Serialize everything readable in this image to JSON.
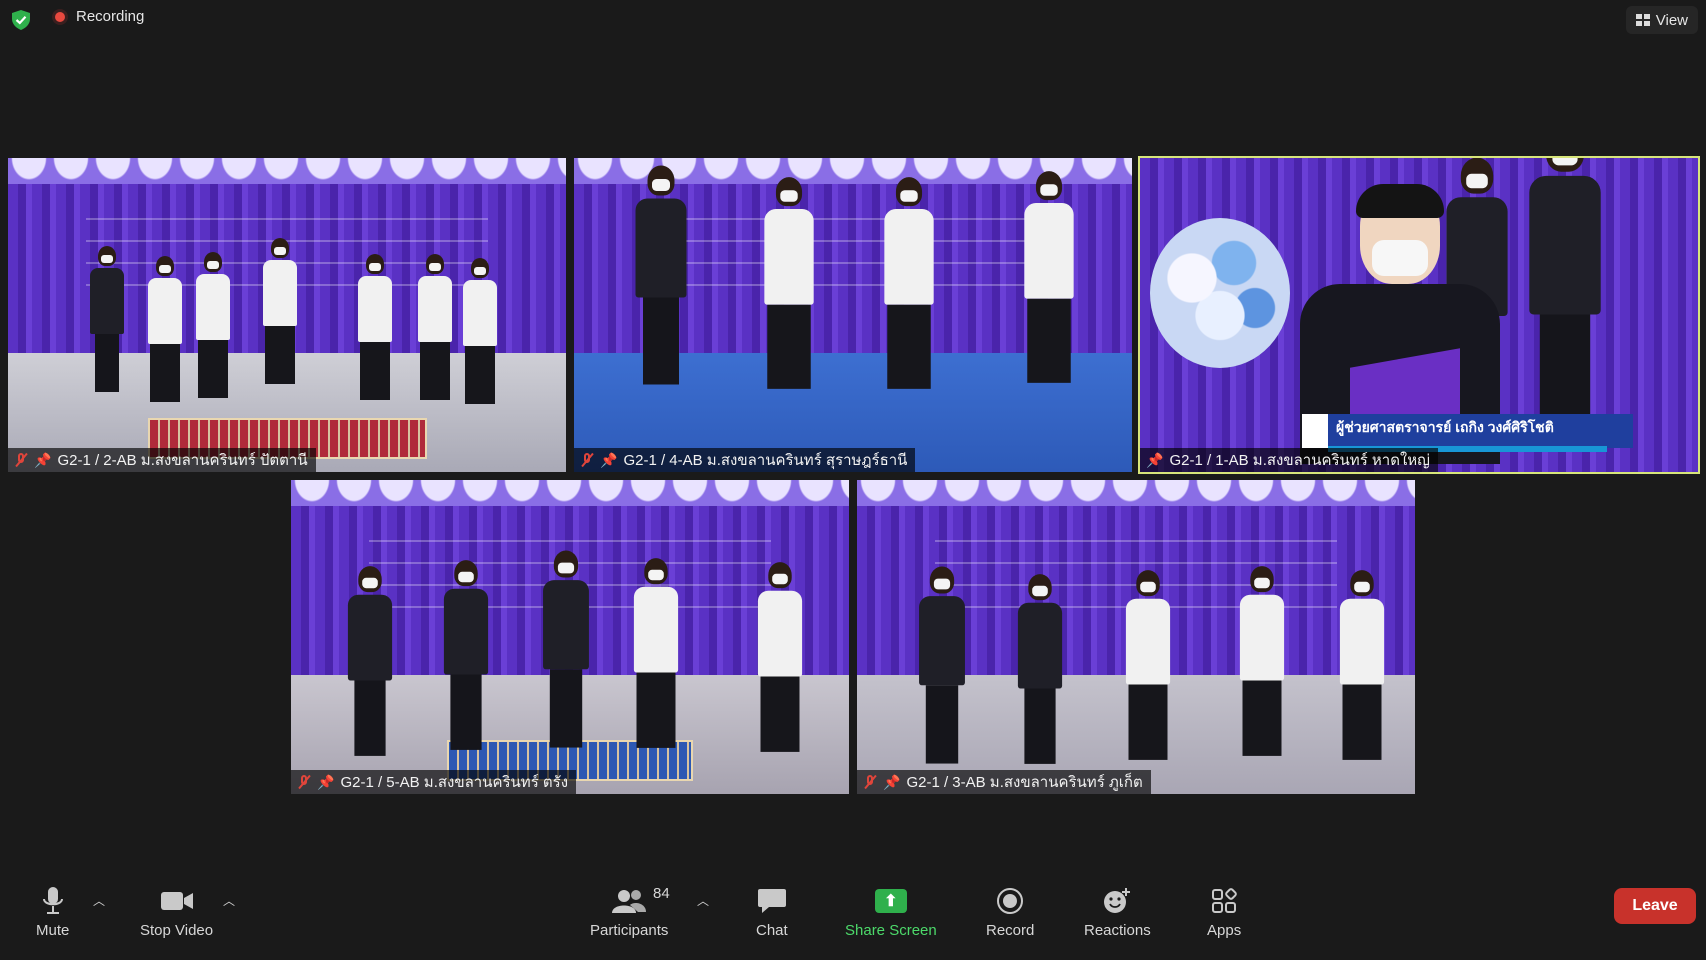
{
  "top": {
    "recording_label": "Recording",
    "view_label": "View"
  },
  "tiles": [
    {
      "label": "G2-1 / 2-AB ม.สงขลานครินทร์ ปัตตานี",
      "muted": true
    },
    {
      "label": "G2-1 / 4-AB ม.สงขลานครินทร์ สุราษฎร์ธานี",
      "muted": true
    },
    {
      "label": "G2-1 / 1-AB ม.สงขลานครินทร์ หาดใหญ่",
      "muted": false,
      "overlay_name": "ผู้ช่วยศาสตราจารย์ เถกิง วงศ์ศิริโชติ"
    },
    {
      "label": "G2-1 / 5-AB ม.สงขลานครินทร์ ตรัง",
      "muted": true
    },
    {
      "label": "G2-1 / 3-AB ม.สงขลานครินทร์ ภูเก็ต",
      "muted": true
    }
  ],
  "toolbar": {
    "mute": "Mute",
    "stop_video": "Stop Video",
    "participants": "Participants",
    "participants_count": "84",
    "chat": "Chat",
    "share_screen": "Share Screen",
    "record": "Record",
    "reactions": "Reactions",
    "apps": "Apps",
    "leave": "Leave"
  },
  "colors": {
    "active_speaker_border": "#d7e57a",
    "share_green": "#2fb04c",
    "leave_red": "#c8322b",
    "mute_red": "#e0453b"
  }
}
